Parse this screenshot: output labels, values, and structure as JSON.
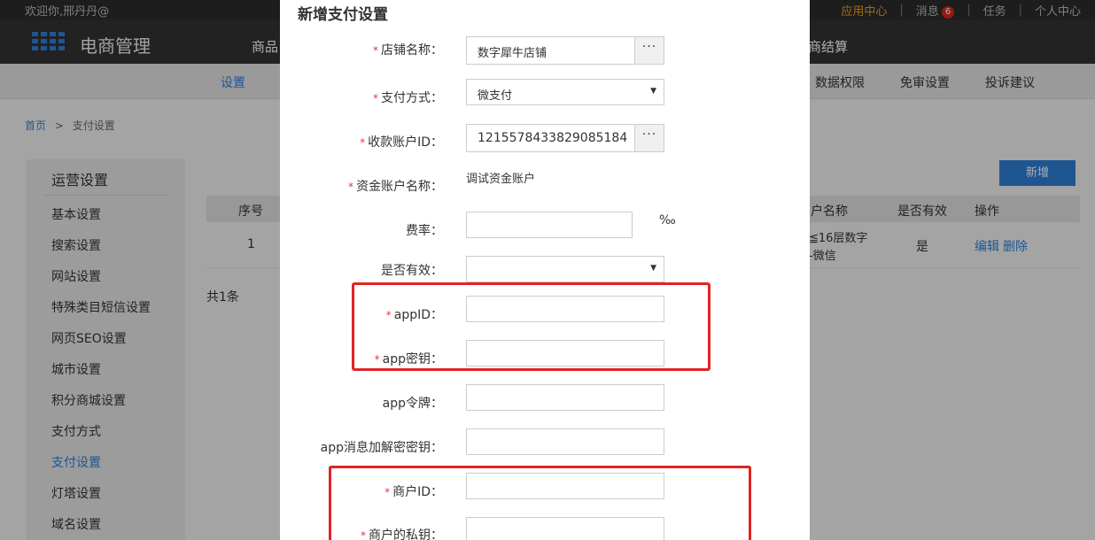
{
  "topbar": {
    "welcome": "欢迎你,邢丹丹@",
    "app_center": "应用中心",
    "messages": "消息",
    "message_count": "6",
    "tasks": "任务",
    "personal_center": "个人中心"
  },
  "header": {
    "logo_text": "电商管理",
    "nav_left": "商品",
    "nav_right": "商结算"
  },
  "subnav": {
    "settings": "设置",
    "data_permission": "数据权限",
    "exemption_settings": "免审设置",
    "complaints": "投诉建议"
  },
  "breadcrumb": {
    "home": "首页",
    "separator": ">",
    "current": "支付设置"
  },
  "sidebar": {
    "title": "运营设置",
    "items": [
      "基本设置",
      "搜索设置",
      "网站设置",
      "特殊类目短信设置",
      "网页SEO设置",
      "城市设置",
      "积分商城设置",
      "支付方式",
      "支付设置",
      "灯塔设置",
      "域名设置"
    ],
    "active_index": 8
  },
  "main": {
    "add_button": "新增",
    "columns": {
      "index": "序号",
      "account_name": "户名称",
      "is_valid": "是否有效",
      "actions": "操作"
    },
    "row": {
      "index": "1",
      "account_name_line1": "≦16层数字",
      "account_name_line2": "-微信",
      "is_valid": "是",
      "edit": "编辑",
      "delete": "删除"
    },
    "total": "共1条"
  },
  "modal": {
    "title": "新增支付设置",
    "fields": {
      "store_name": {
        "label": "店铺名称：",
        "value": "数字犀牛店铺",
        "button": "···"
      },
      "pay_method": {
        "label": "支付方式：",
        "value": "微支付"
      },
      "account_id": {
        "label": "收款账户ID：",
        "value": "1215578433829085184",
        "button": "···"
      },
      "fund_account": {
        "label": "资金账户名称：",
        "value": "调试资金账户"
      },
      "rate": {
        "label": "费率：",
        "value": "",
        "unit": "‰"
      },
      "is_valid": {
        "label": "是否有效：",
        "value": ""
      },
      "app_id": {
        "label": "appID：",
        "value": ""
      },
      "app_secret": {
        "label": "app密钥：",
        "value": ""
      },
      "app_token": {
        "label": "app令牌：",
        "value": ""
      },
      "app_msg_key": {
        "label": "app消息加解密密钥：",
        "value": ""
      },
      "merchant_id": {
        "label": "商户ID：",
        "value": ""
      },
      "merchant_key": {
        "label": "商户的私钥：",
        "value": ""
      }
    },
    "required_mark": "*",
    "caret": "▼"
  },
  "colors": {
    "accent": "#2f7fd8",
    "highlight": "#e02424",
    "required": "#e4393c",
    "header_bg": "#333333"
  }
}
